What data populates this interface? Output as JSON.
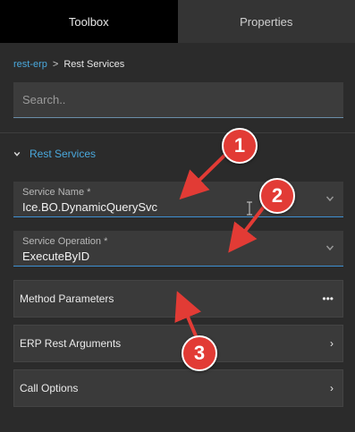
{
  "tabs": [
    {
      "label": "Toolbox",
      "active": true
    },
    {
      "label": "Properties",
      "active": false
    }
  ],
  "breadcrumb": {
    "link": "rest-erp",
    "separator": ">",
    "current": "Rest Services"
  },
  "search": {
    "placeholder": "Search..",
    "value": ""
  },
  "section": {
    "title": "Rest Services",
    "expanded": true
  },
  "fields": [
    {
      "label": "Service Name *",
      "value": "Ice.BO.DynamicQuerySvc"
    },
    {
      "label": "Service Operation *",
      "value": "ExecuteByID"
    }
  ],
  "panels": [
    {
      "label": "Method Parameters",
      "right": "•••"
    },
    {
      "label": "ERP Rest Arguments",
      "right": "›"
    },
    {
      "label": "Call Options",
      "right": "›"
    }
  ],
  "callouts": [
    "1",
    "2",
    "3"
  ],
  "colors": {
    "accent": "#4aa8dc",
    "callout": "#e23b35",
    "background": "#2b2b2b"
  },
  "icons": {
    "section": "chevron-down-icon",
    "fields": "chevron-down-icon",
    "method_parameters": "more-icon",
    "panels": "chevron-right-icon",
    "cursor": "text-cursor-icon"
  }
}
